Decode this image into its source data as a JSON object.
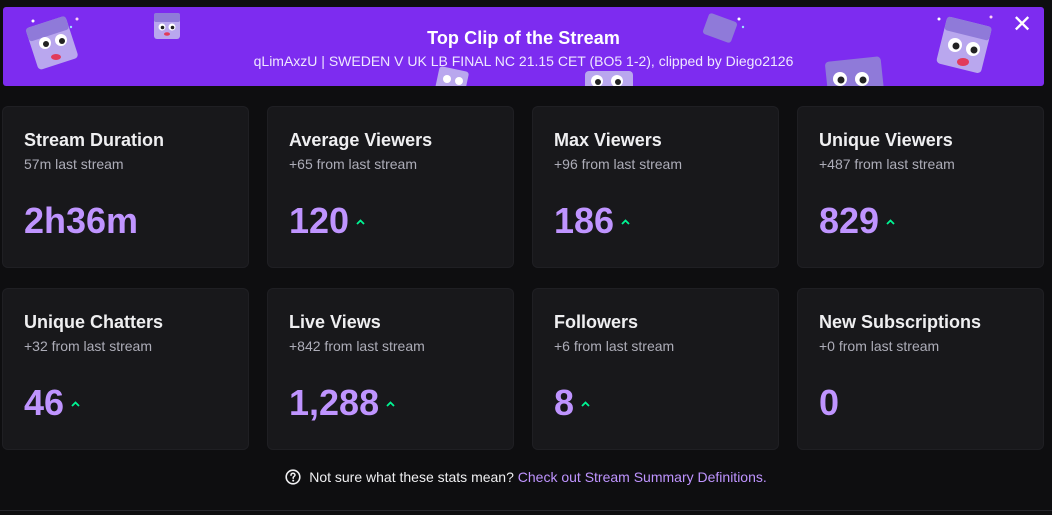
{
  "banner": {
    "title": "Top Clip of the Stream",
    "subtitle": "qLimAxzU | SWEDEN V UK LB FINAL NC 21.15 CET (BO5 1-2), clipped by Diego2126",
    "close_icon": "close-icon",
    "close_glyph": "✕",
    "background_color": "#7d2cf0"
  },
  "colors": {
    "page_bg": "#0e0e10",
    "card_bg": "#18181b",
    "value": "#bf94ff",
    "trend_up": "#00f593",
    "link": "#bf94ff"
  },
  "stats": [
    {
      "title": "Stream Duration",
      "sub": "57m last stream",
      "value": "2h36m",
      "trend": "none"
    },
    {
      "title": "Average Viewers",
      "sub": "+65 from last stream",
      "value": "120",
      "trend": "up"
    },
    {
      "title": "Max Viewers",
      "sub": "+96 from last stream",
      "value": "186",
      "trend": "up"
    },
    {
      "title": "Unique Viewers",
      "sub": "+487 from last stream",
      "value": "829",
      "trend": "up"
    },
    {
      "title": "Unique Chatters",
      "sub": "+32 from last stream",
      "value": "46",
      "trend": "up"
    },
    {
      "title": "Live Views",
      "sub": "+842 from last stream",
      "value": "1,288",
      "trend": "up"
    },
    {
      "title": "Followers",
      "sub": "+6 from last stream",
      "value": "8",
      "trend": "up"
    },
    {
      "title": "New Subscriptions",
      "sub": "+0 from last stream",
      "value": "0",
      "trend": "none"
    }
  ],
  "footer": {
    "help_icon": "question-circle-icon",
    "text": "Not sure what these stats mean?",
    "link_text": "Check out Stream Summary Definitions."
  }
}
